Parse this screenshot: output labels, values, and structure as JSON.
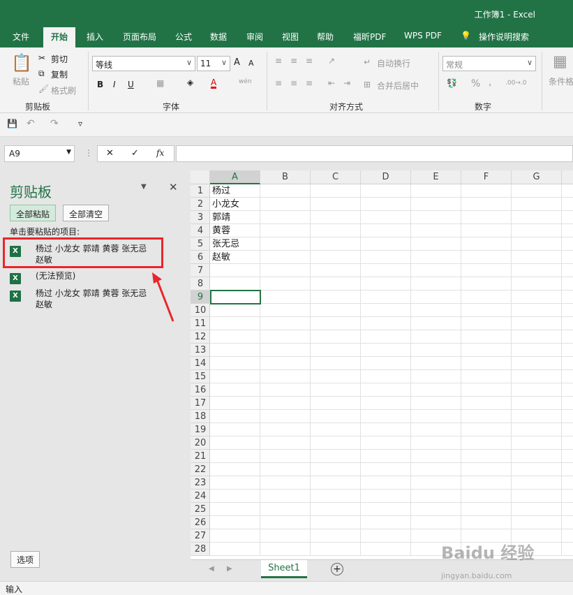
{
  "window": {
    "title": "工作簿1 - Excel"
  },
  "tabs": [
    "文件",
    "开始",
    "插入",
    "页面布局",
    "公式",
    "数据",
    "审阅",
    "视图",
    "帮助",
    "福昕PDF",
    "WPS PDF",
    "操作说明搜索"
  ],
  "ribbon": {
    "clipboard": {
      "paste": "粘贴",
      "cut": "剪切",
      "copy": "复制",
      "format_painter": "格式刷",
      "label": "剪贴板"
    },
    "font": {
      "name": "等线",
      "size": "11",
      "bold": "B",
      "italic": "I",
      "underline": "U",
      "grow": "A",
      "shrink": "A",
      "label": "字体"
    },
    "align": {
      "wrap": "自动换行",
      "merge": "合并后居中",
      "label": "对齐方式"
    },
    "number": {
      "format": "常规",
      "percent": "%",
      "comma": ",",
      "inc": ".00→.0",
      "label": "数字"
    },
    "styles": {
      "cond": "条件格"
    }
  },
  "formula_bar": {
    "name_box": "A9",
    "cancel": "✕",
    "enter": "✓",
    "fx": "fx",
    "value": ""
  },
  "pane": {
    "title": "剪贴板",
    "paste_all": "全部粘贴",
    "clear_all": "全部清空",
    "hint": "单击要粘贴的项目:",
    "items": [
      {
        "icon": "X",
        "text": "杨过 小龙女 郭靖 黄蓉 张无忌 赵敏"
      },
      {
        "icon": "X",
        "text": "(无法预览)"
      },
      {
        "icon": "X",
        "text": "杨过 小龙女 郭靖 黄蓉 张无忌 赵敏"
      }
    ],
    "options": "选项"
  },
  "grid": {
    "columns": [
      "A",
      "B",
      "C",
      "D",
      "E",
      "F",
      "G"
    ],
    "rows": [
      "1",
      "2",
      "3",
      "4",
      "5",
      "6",
      "7",
      "8",
      "9",
      "10",
      "11",
      "12",
      "13",
      "14",
      "15",
      "16",
      "17",
      "18",
      "19",
      "20",
      "21",
      "22",
      "23",
      "24",
      "25",
      "26",
      "27",
      "28"
    ],
    "colA": [
      "杨过",
      "小龙女",
      "郭靖",
      "黄蓉",
      "张无忌",
      "赵敏"
    ]
  },
  "sheet": {
    "name": "Sheet1",
    "add": "+"
  },
  "status": {
    "mode": "输入"
  },
  "watermark": {
    "logo": "Baidu 经验",
    "url": "jingyan.baidu.com"
  },
  "colors": {
    "accent": "#217346",
    "highlight": "#e8262c"
  }
}
